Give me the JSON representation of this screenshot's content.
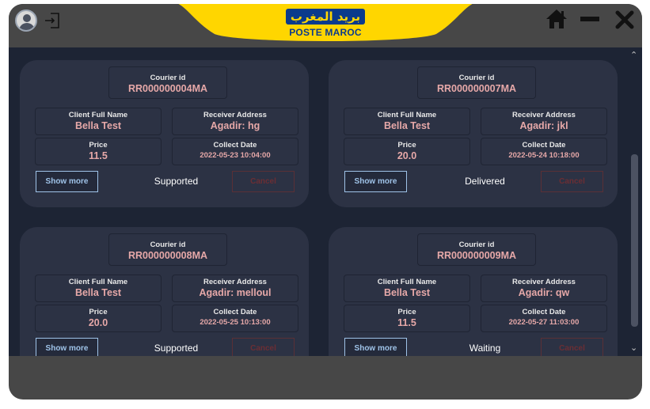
{
  "brand": {
    "arabic": "بريد المغرب",
    "latin": "POSTE MAROC"
  },
  "labels": {
    "courier_id": "Courier id",
    "client_full_name": "Client Full Name",
    "receiver_address": "Receiver Address",
    "price": "Price",
    "collect_date": "Collect Date",
    "show_more": "Show more",
    "cancel": "Cancel"
  },
  "couriers": [
    {
      "id": "RR000000004MA",
      "client": "Bella Test",
      "address": "Agadir: hg",
      "price": "11.5",
      "date": "2022-05-23 10:04:00",
      "status": "Supported"
    },
    {
      "id": "RR000000007MA",
      "client": "Bella Test",
      "address": "Agadir: jkl",
      "price": "20.0",
      "date": "2022-05-24 10:18:00",
      "status": "Delivered"
    },
    {
      "id": "RR000000008MA",
      "client": "Bella Test",
      "address": "Agadir: melloul",
      "price": "20.0",
      "date": "2022-05-25 10:13:00",
      "status": "Supported"
    },
    {
      "id": "RR000000009MA",
      "client": "Bella Test",
      "address": "Agadir: qw",
      "price": "11.5",
      "date": "2022-05-27 11:03:00",
      "status": "Waiting"
    }
  ],
  "colors": {
    "accent": "#ffd600",
    "brand_blue": "#0b3b8c",
    "card": "#2c3244",
    "value": "#e6a8a8"
  }
}
